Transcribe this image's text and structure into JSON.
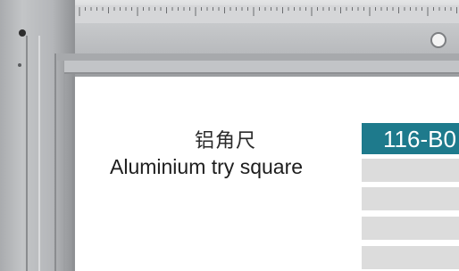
{
  "product": {
    "name_cn": "铝角尺",
    "name_en": "Aluminium try square",
    "model": "116-B0"
  },
  "spec_table": {
    "header_color": "#1e7a8c",
    "row_color": "#dcdcdc",
    "rows": [
      "",
      "",
      "",
      ""
    ]
  },
  "tool": {
    "material": "aluminium",
    "color": "#b9bbbe"
  }
}
